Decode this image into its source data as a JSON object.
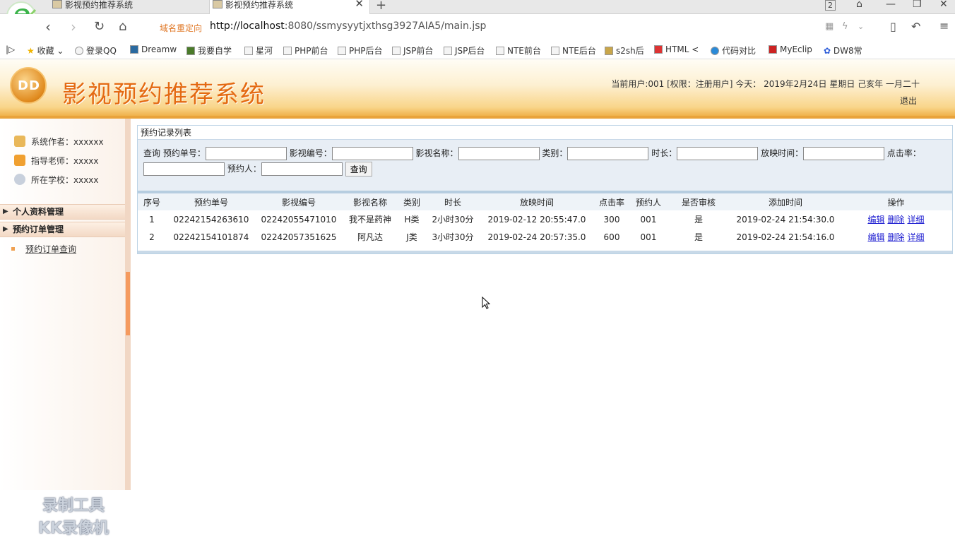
{
  "browser": {
    "tabs": [
      {
        "label": "影视预约推荐系统"
      },
      {
        "label": "影视预约推荐系统"
      }
    ],
    "new_tab": "+",
    "tab_count": "2",
    "redirect_label": "域名重定向",
    "url_host": "http://localhost",
    "url_rest": ":8080/ssmysyytjxthsg3927AIA5/main.jsp",
    "bookmarks": [
      {
        "label": "收藏"
      },
      {
        "label": "登录QQ"
      },
      {
        "label": "Dreamw"
      },
      {
        "label": "我要自学"
      },
      {
        "label": "星河"
      },
      {
        "label": "PHP前台"
      },
      {
        "label": "PHP后台"
      },
      {
        "label": "JSP前台"
      },
      {
        "label": "JSP后台"
      },
      {
        "label": "NTE前台"
      },
      {
        "label": "NTE后台"
      },
      {
        "label": "s2sh后"
      },
      {
        "label": "HTML <"
      },
      {
        "label": "代码对比"
      },
      {
        "label": "MyEclip"
      },
      {
        "label": "DW8常"
      }
    ]
  },
  "header": {
    "logo_text": "DD",
    "title": "影视预约推荐系统",
    "user_info": "当前用户:001 [权限：注册用户] 今天： 2019年2月24日 星期日 己亥年 一月二十",
    "logout": "退出"
  },
  "sidebar": {
    "info": [
      {
        "label": "系统作者：xxxxxx"
      },
      {
        "label": "指导老师：xxxxx"
      },
      {
        "label": "所在学校：xxxxx"
      }
    ],
    "menus": [
      {
        "label": "个人资料管理"
      },
      {
        "label": "预约订单管理"
      }
    ],
    "sub_item": "预约订单查询",
    "watermark_line1": "录制工具",
    "watermark_line2": "KK录像机"
  },
  "panel": {
    "title": "预约记录列表",
    "search": {
      "lead": "查询",
      "fields": [
        {
          "label": "预约单号：",
          "value": ""
        },
        {
          "label": "影视编号：",
          "value": ""
        },
        {
          "label": "影视名称：",
          "value": ""
        },
        {
          "label": "类别：",
          "value": ""
        },
        {
          "label": "时长：",
          "value": ""
        },
        {
          "label": "放映时间：",
          "value": ""
        },
        {
          "label": "点击率：",
          "value": ""
        },
        {
          "label": "预约人：",
          "value": ""
        }
      ],
      "button": "查询"
    },
    "columns": [
      "序号",
      "预约单号",
      "影视编号",
      "影视名称",
      "类别",
      "时长",
      "放映时间",
      "点击率",
      "预约人",
      "是否审核",
      "添加时间",
      "操作"
    ],
    "rows": [
      {
        "no": "1",
        "order_no": "02242154263610",
        "film_no": "02242055471010",
        "film_name": "我不是药神",
        "category": "H类",
        "duration": "2小时30分",
        "show_time": "2019-02-12 20:55:47.0",
        "clicks": "300",
        "user": "001",
        "audited": "是",
        "added": "2019-02-24 21:54:30.0"
      },
      {
        "no": "2",
        "order_no": "02242154101874",
        "film_no": "02242057351625",
        "film_name": "阿凡达",
        "category": "J类",
        "duration": "3小时30分",
        "show_time": "2019-02-24 20:57:35.0",
        "clicks": "600",
        "user": "001",
        "audited": "是",
        "added": "2019-02-24 21:54:16.0"
      }
    ],
    "actions": {
      "edit": "编辑",
      "delete": "删除",
      "detail": "详细"
    }
  }
}
